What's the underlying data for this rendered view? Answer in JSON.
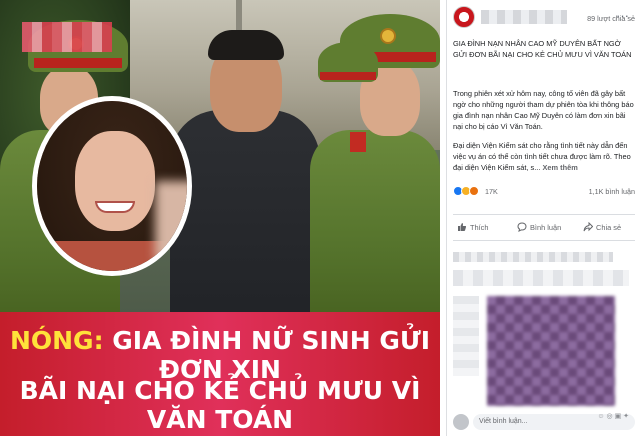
{
  "image": {
    "banner_line1_prefix": "NÓNG:",
    "banner_line1_rest": " GIA ĐÌNH NỮ SINH GỬI ĐƠN XIN",
    "banner_line2": "BÃI NẠI CHO KẺ CHỦ MƯU VÌ VĂN TOÁN"
  },
  "post": {
    "title": "GIA ĐÌNH NẠN NHÂN CAO MỸ DUYÊN BẤT NGỜ GỬI ĐƠN BÃI NẠI CHO KẺ CHỦ MƯU VÌ VĂN TOÁN",
    "paragraph2": "Trong phiên xét xử hôm nay, công tố viên đã gây bất ngờ cho những người tham dự phiên tòa khi thông báo gia đình nạn nhân Cao Mỹ Duyên có làm đơn xin bãi nại cho bị cáo Vì Văn Toán.",
    "paragraph3": "Đại diện Viện Kiểm sát cho rằng tình tiết này dẫn đến việc vụ án có thể còn tình tiết chưa được làm rõ. Theo đại diện Viện Kiểm sát, s...",
    "see_more": "Xem thêm",
    "reaction_count": "17K",
    "comments": "1,1K bình luận",
    "shares": "89 lượt chia sẻ"
  },
  "actions": {
    "like": "Thích",
    "comment": "Bình luận",
    "share": "Chia sẻ"
  },
  "composer": {
    "placeholder": "Viết bình luận..."
  },
  "colors": {
    "banner": "#c41e2b",
    "highlight": "#ffe23a",
    "like_blue": "#1877f2"
  }
}
